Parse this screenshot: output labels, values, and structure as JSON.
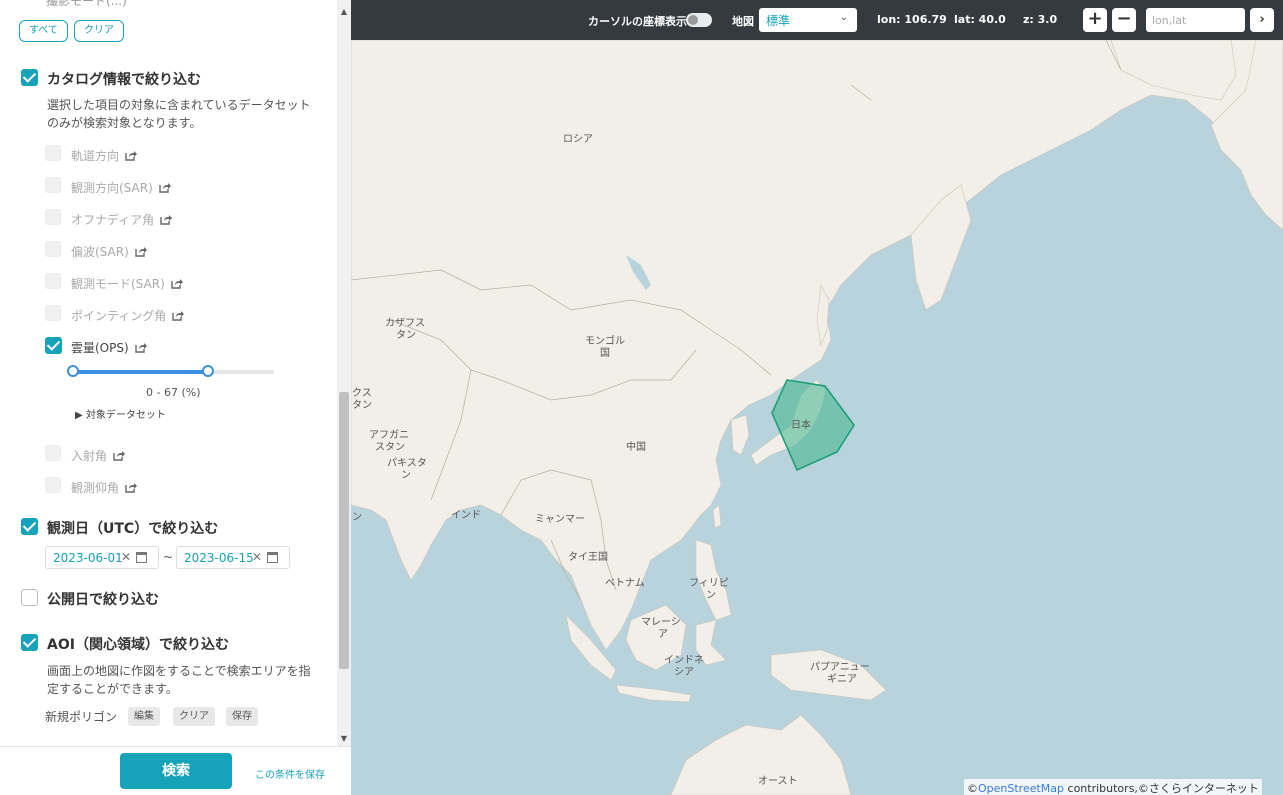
{
  "sidebar": {
    "top_cut_text": "撮影モード(...)",
    "buttons": {
      "all": "すべて",
      "clear": "クリア"
    },
    "catalog": {
      "title": "カタログ情報で絞り込む",
      "desc1": "選択した項目の対象に含まれているデータセット",
      "desc2": "のみが検索対象となります。",
      "items": [
        {
          "label": "軌道方向"
        },
        {
          "label": "観測方向(SAR)"
        },
        {
          "label": "オフナディア角"
        },
        {
          "label": "偏波(SAR)"
        },
        {
          "label": "観測モード(SAR)"
        },
        {
          "label": "ポインティング角"
        },
        {
          "label": "雲量(OPS)"
        },
        {
          "label": "入射角"
        },
        {
          "label": "観測仰角"
        }
      ],
      "cloud_range": {
        "text": "0 - 67 (%)",
        "min": 0,
        "max": 67,
        "scale_max": 100
      },
      "target_dataset": "対象データセット"
    },
    "obs_date": {
      "title": "観測日（UTC）で絞り込む",
      "start": "2023-06-01",
      "end": "2023-06-15",
      "separator": "~"
    },
    "pub_date": {
      "title": "公開日で絞り込む"
    },
    "aoi": {
      "title": "AOI（関心領域）で絞り込む",
      "desc1": "画面上の地図に作図をすることで検索エリアを指",
      "desc2": "定することができます。",
      "polygon_label": "新規ポリゴン",
      "edit": "編集",
      "clear": "クリア",
      "save": "保存"
    },
    "footer": {
      "search": "検索",
      "save_conditions": "この条件を保存"
    }
  },
  "toolbar": {
    "cursor_coords": "カーソルの座標表示",
    "map_label": "地図",
    "map_select": "標準",
    "lon": "lon: 106.79",
    "lat": "lat: 40.0",
    "zoom": "z: 3.0",
    "zoom_in": "+",
    "zoom_out": "−",
    "coord_placeholder": "lon,lat",
    "go": "›"
  },
  "map": {
    "labels": {
      "russia": "ロシア",
      "kazakhstan1": "カザフス",
      "kazakhstan2": "タン",
      "mongolia1": "モンゴル",
      "mongolia2": "国",
      "china": "中国",
      "japan": "日本",
      "afghanistan1": "アフガニ",
      "afghanistan2": "スタン",
      "pakistan1": "パキスタ",
      "pakistan2": "ン",
      "india": "インド",
      "myanmar": "ミャンマー",
      "thailand": "タイ王国",
      "vietnam": "ベトナム",
      "philippines1": "フィリピ",
      "philippines2": "ン",
      "malaysia1": "マレーシ",
      "malaysia2": "ア",
      "indonesia1": "インドネ",
      "indonesia2": "シア",
      "png1": "パプアニュー",
      "png2": "ギニア",
      "australia": "オースト",
      "edge1": "クス",
      "edge2": "タン",
      "edge3": "ン"
    },
    "attribution_prefix": "©",
    "attribution_link": "OpenStreetMap",
    "attribution_suffix": " contributors,©さくらインターネット",
    "colors": {
      "sea": "#b9d3dc",
      "land": "#f2efe9",
      "aoi_fill": "#3fb58e",
      "aoi_stroke": "#1f9e78"
    }
  }
}
